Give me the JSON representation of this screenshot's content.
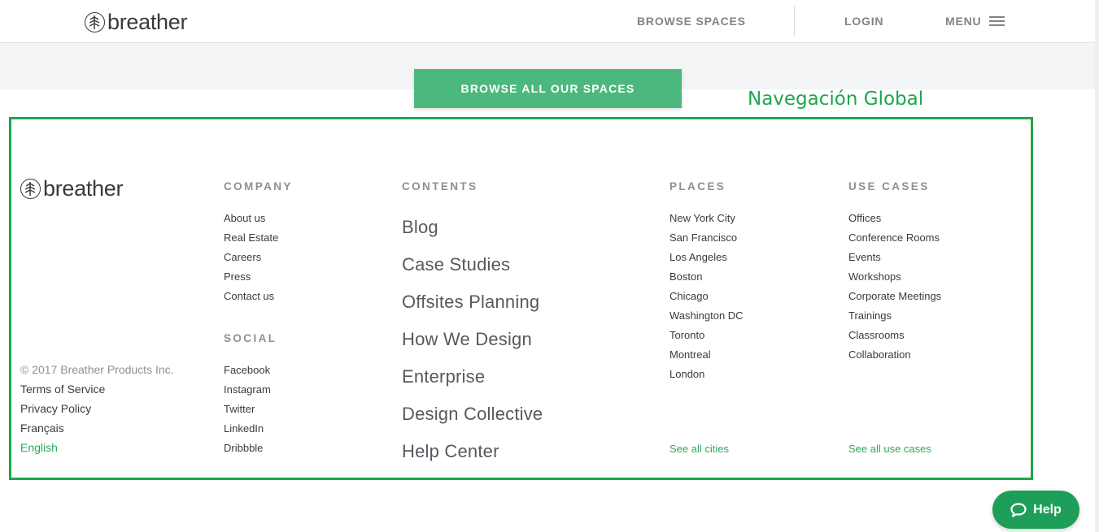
{
  "header": {
    "brand": "breather",
    "nav": {
      "browse_spaces": "BROWSE SPACES",
      "login": "LOGIN",
      "menu": "MENU"
    }
  },
  "hero": {
    "browse_all_button": "BROWSE ALL OUR SPACES"
  },
  "annotation": {
    "title": "Navegación Global",
    "color": "#1fa64a"
  },
  "footer": {
    "brand": "breather",
    "company": {
      "heading": "COMPANY",
      "items": [
        "About us",
        "Real Estate",
        "Careers",
        "Press",
        "Contact us"
      ]
    },
    "social": {
      "heading": "SOCIAL",
      "items": [
        "Facebook",
        "Instagram",
        "Twitter",
        "LinkedIn",
        "Dribbble"
      ]
    },
    "contents": {
      "heading": "CONTENTS",
      "items": [
        "Blog",
        "Case Studies",
        "Offsites Planning",
        "How We Design",
        "Enterprise",
        "Design Collective",
        "Help Center"
      ]
    },
    "places": {
      "heading": "PLACES",
      "items": [
        "New York City",
        "San Francisco",
        "Los Angeles",
        "Boston",
        "Chicago",
        "Washington DC",
        "Toronto",
        "Montreal",
        "London"
      ],
      "see_all": "See all cities"
    },
    "use_cases": {
      "heading": "USE CASES",
      "items": [
        "Offices",
        "Conference Rooms",
        "Events",
        "Workshops",
        "Corporate Meetings",
        "Trainings",
        "Classrooms",
        "Collaboration"
      ],
      "see_all": "See all use cases"
    },
    "legal": {
      "copyright": "© 2017 Breather Products Inc.",
      "terms": "Terms of Service",
      "privacy": "Privacy Policy",
      "lang_fr": "Français",
      "lang_en": "English"
    }
  },
  "help_button": {
    "label": "Help"
  },
  "colors": {
    "brand_green": "#4db87e",
    "link_green": "#2da85d",
    "help_green": "#1e9f59"
  },
  "icons": {
    "brand_mark": "tree-circle-icon",
    "menu": "hamburger-icon",
    "help": "chat-bubble-icon"
  }
}
